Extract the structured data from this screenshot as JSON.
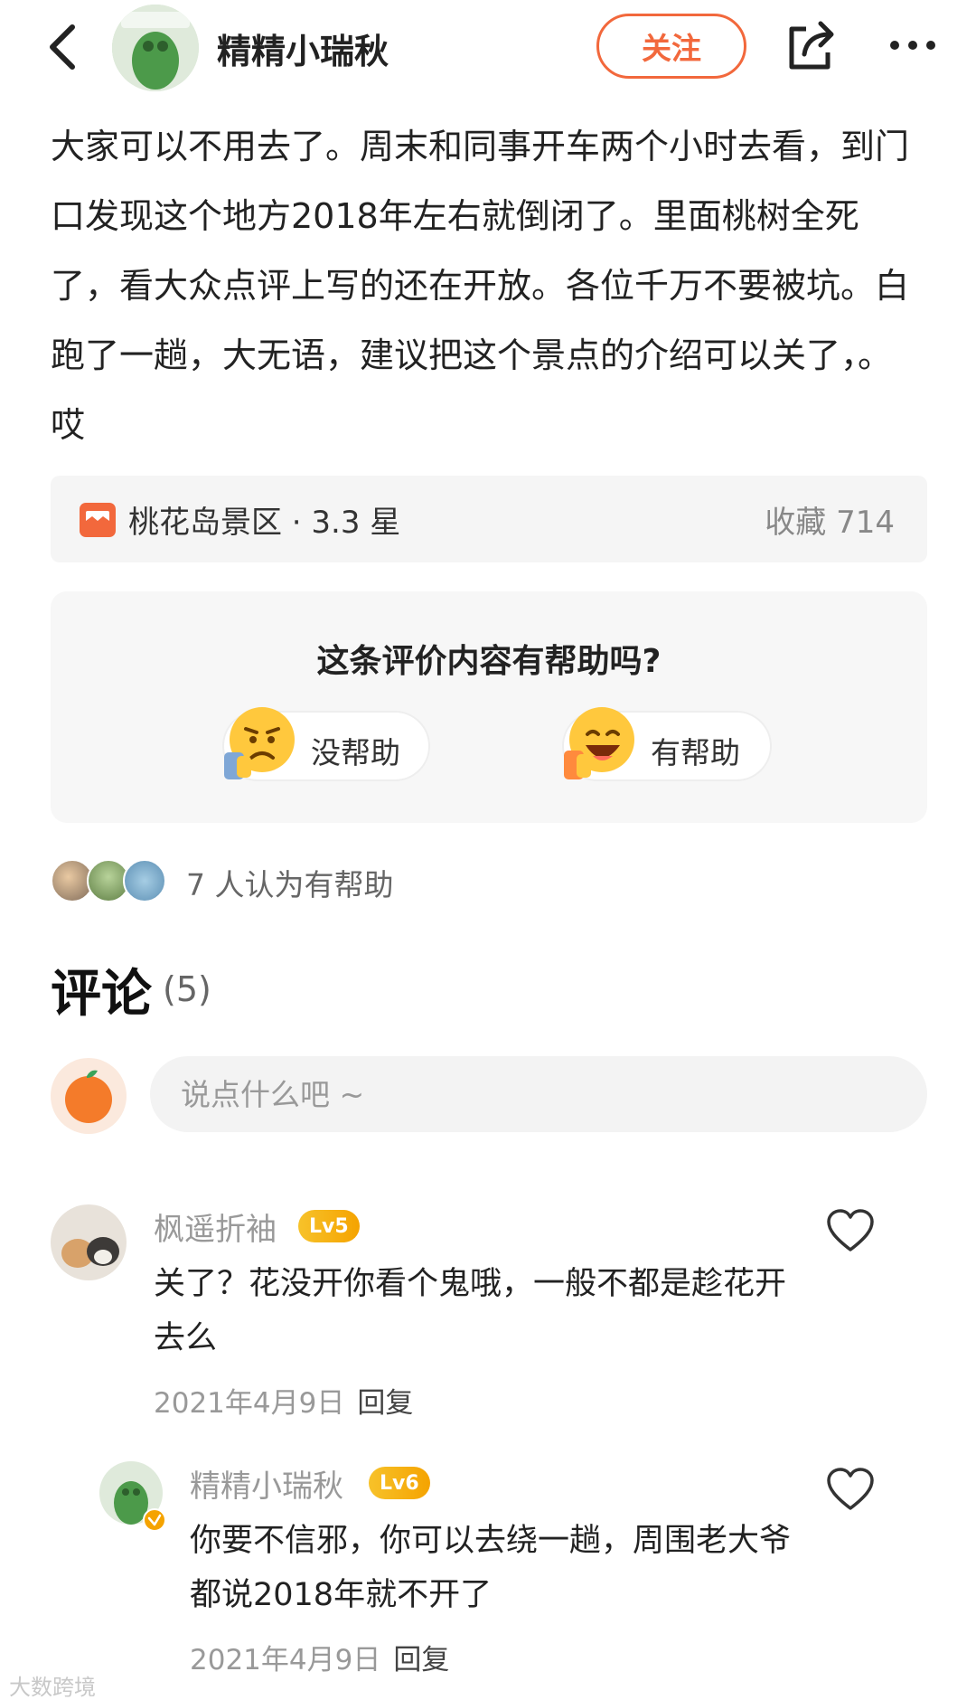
{
  "header": {
    "author_name": "精精小瑞秋",
    "follow_label": "关注"
  },
  "review": {
    "text": "大家可以不用去了。周末和同事开车两个小时去看，到门口发现这个地方2018年左右就倒闭了。里面桃树全死了，看大众点评上写的还在开放。各位千万不要被坑。白跑了一趟，大无语，建议把这个景点的介绍可以关了，。哎"
  },
  "place": {
    "name_rating": "桃花岛景区 · 3.3 星",
    "favorites": "收藏 714"
  },
  "helpful": {
    "question": "这条评价内容有帮助吗?",
    "no_label": "没帮助",
    "yes_label": "有帮助",
    "count_text": "7 人认为有帮助"
  },
  "comments": {
    "title": "评论",
    "count": "(5)",
    "input_placeholder": "说点什么吧 ~",
    "items": [
      {
        "name": "枫遥折袖",
        "level": "Lv5",
        "body": "关了？花没开你看个鬼哦，一般不都是趁花开去么",
        "date": "2021年4月9日",
        "reply": "回复"
      },
      {
        "name": "精精小瑞秋",
        "level": "Lv6",
        "body": "你要不信邪，你可以去绕一趟，周围老大爷都说2018年就不开了",
        "date": "2021年4月9日",
        "reply": "回复"
      }
    ]
  },
  "watermark": "大数跨境",
  "colors": {
    "accent": "#f2683c",
    "level_badge": "#f5a300",
    "card_bg": "#f5f5f5"
  },
  "icons": [
    "back-arrow-icon",
    "share-icon",
    "more-icon",
    "place-icon",
    "unhappy-emoji-icon",
    "happy-emoji-icon",
    "heart-icon"
  ]
}
